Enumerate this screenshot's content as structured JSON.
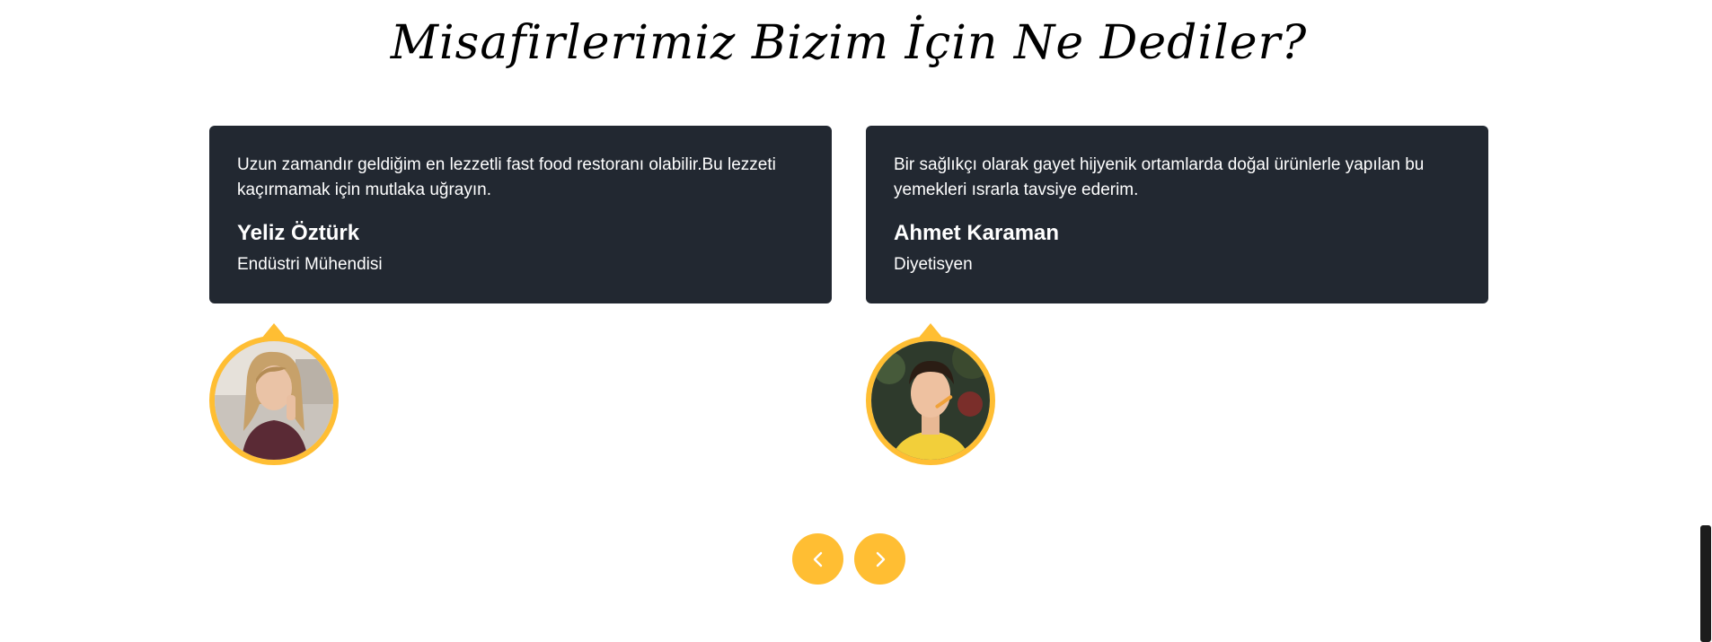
{
  "section": {
    "title": "Misafirlerimiz Bizim İçin Ne Dediler?"
  },
  "testimonials": [
    {
      "quote": "Uzun zamandır geldiğim en lezzetli fast food restoranı olabilir.Bu lezzeti kaçırmamak için mutlaka uğrayın.",
      "name": "Yeliz Öztürk",
      "role": "Endüstri Mühendisi"
    },
    {
      "quote": "Bir sağlıkçı olarak gayet hijyenik ortamlarda doğal ürünlerle yapılan bu yemekleri ısrarla tavsiye ederim.",
      "name": "Ahmet Karaman",
      "role": "Diyetisyen"
    }
  ],
  "carousel": {
    "prev_icon": "chevron-left-icon",
    "next_icon": "chevron-right-icon"
  },
  "colors": {
    "accent": "#ffbe33",
    "card_bg": "#222831",
    "card_text": "#ffffff"
  }
}
